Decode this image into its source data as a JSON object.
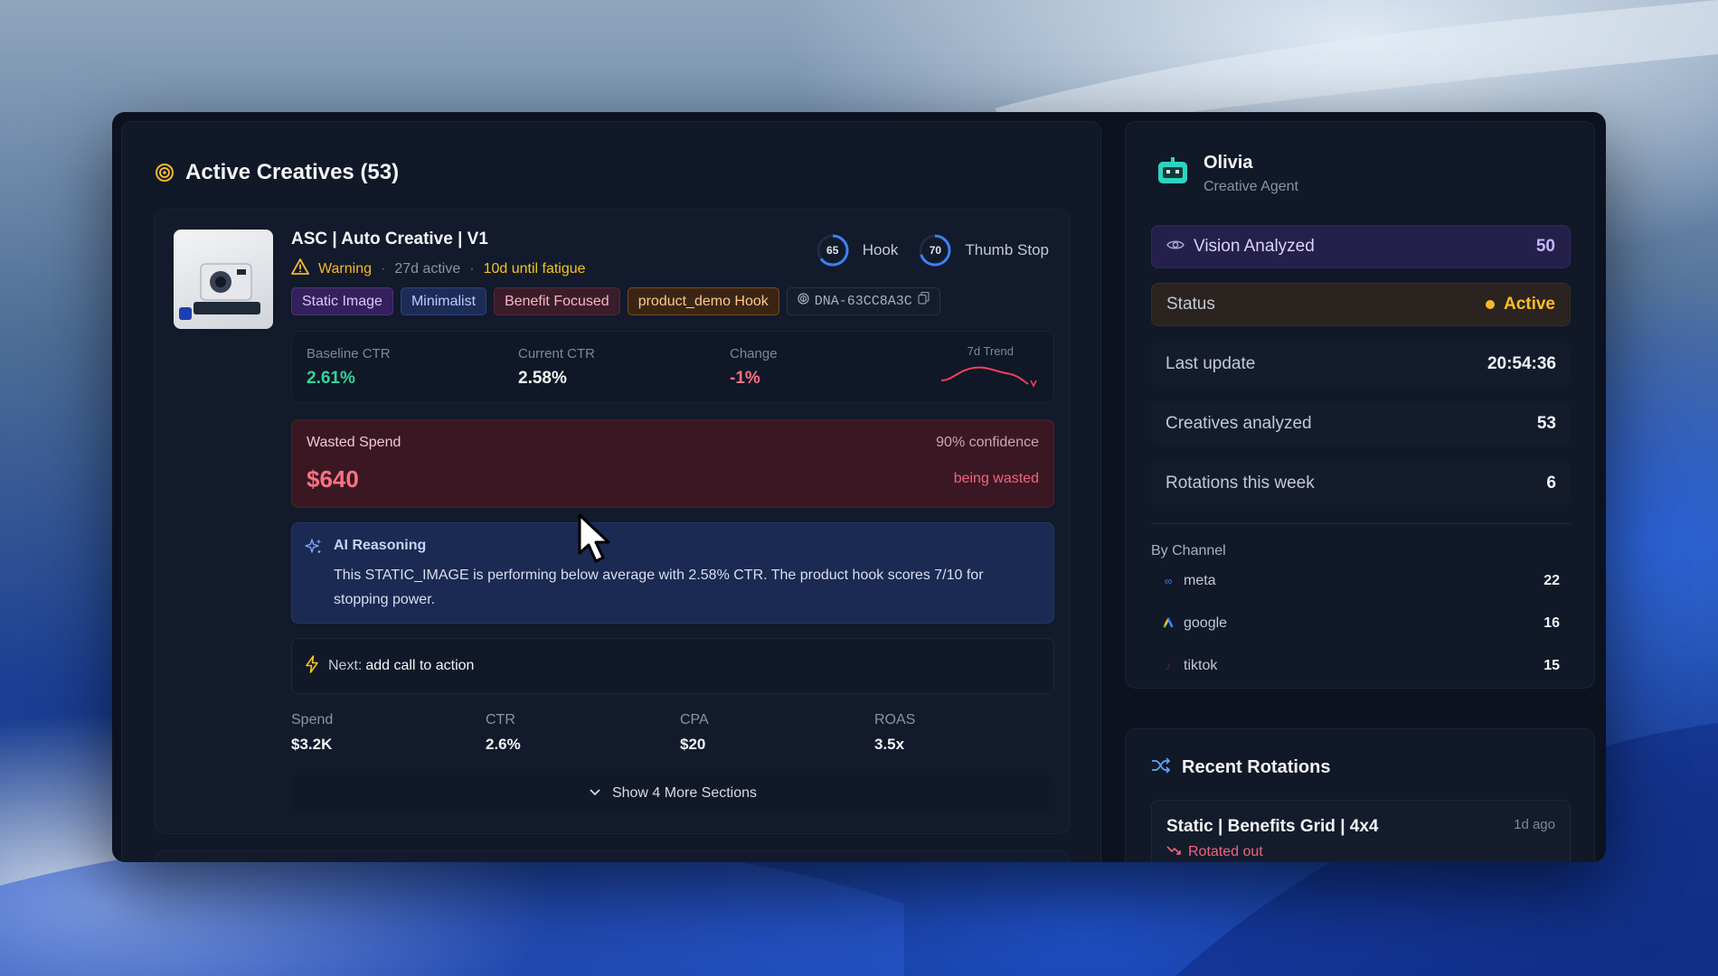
{
  "creatives": {
    "header_title": "Active Creatives (53)",
    "card": {
      "title": "ASC | Auto Creative | V1",
      "status": "Warning",
      "active_days": "27d active",
      "fatigue": "10d until fatigue",
      "hook_score": "65",
      "hook_label": "Hook",
      "thumb_stop_score": "70",
      "thumb_stop_label": "Thumb Stop",
      "tags": [
        "Static Image",
        "Minimalist",
        "Benefit Focused",
        "product_demo Hook"
      ],
      "dna": "DNA-63CC8A3C",
      "ctr": {
        "baseline_label": "Baseline CTR",
        "baseline_value": "2.61%",
        "current_label": "Current CTR",
        "current_value": "2.58%",
        "change_label": "Change",
        "change_value": "-1%",
        "trend_label": "7d Trend"
      },
      "wasted": {
        "label": "Wasted Spend",
        "amount": "$640",
        "confidence": "90% confidence",
        "note": "being wasted"
      },
      "ai": {
        "label": "AI Reasoning",
        "text": "This STATIC_IMAGE is performing below average with 2.58% CTR. The product hook scores 7/10 for stopping power."
      },
      "next": {
        "label": "Next:",
        "value": "add call to action"
      },
      "metrics": [
        {
          "label": "Spend",
          "value": "$3.2K"
        },
        {
          "label": "CTR",
          "value": "2.6%"
        },
        {
          "label": "CPA",
          "value": "$20"
        },
        {
          "label": "ROAS",
          "value": "3.5x"
        }
      ],
      "show_more": "Show 4 More Sections"
    }
  },
  "agent": {
    "name": "Olivia",
    "role": "Creative Agent",
    "vision_label": "Vision Analyzed",
    "vision_value": "50",
    "status_label": "Status",
    "status_value": "Active",
    "last_update_label": "Last update",
    "last_update_value": "20:54:36",
    "creatives_label": "Creatives analyzed",
    "creatives_value": "53",
    "rotations_label": "Rotations this week",
    "rotations_value": "6",
    "by_channel_label": "By Channel",
    "channels": [
      {
        "name": "meta",
        "count": "22"
      },
      {
        "name": "google",
        "count": "16"
      },
      {
        "name": "tiktok",
        "count": "15"
      }
    ]
  },
  "rotations": {
    "title": "Recent Rotations",
    "items": [
      {
        "name": "Static | Benefits Grid | 4x4",
        "time": "1d ago",
        "state": "Rotated out"
      }
    ]
  },
  "colors": {
    "accent_warning": "#f5b82e",
    "positive": "#34d399",
    "negative": "#fb7185",
    "vision_accent": "#c4b5fd"
  }
}
